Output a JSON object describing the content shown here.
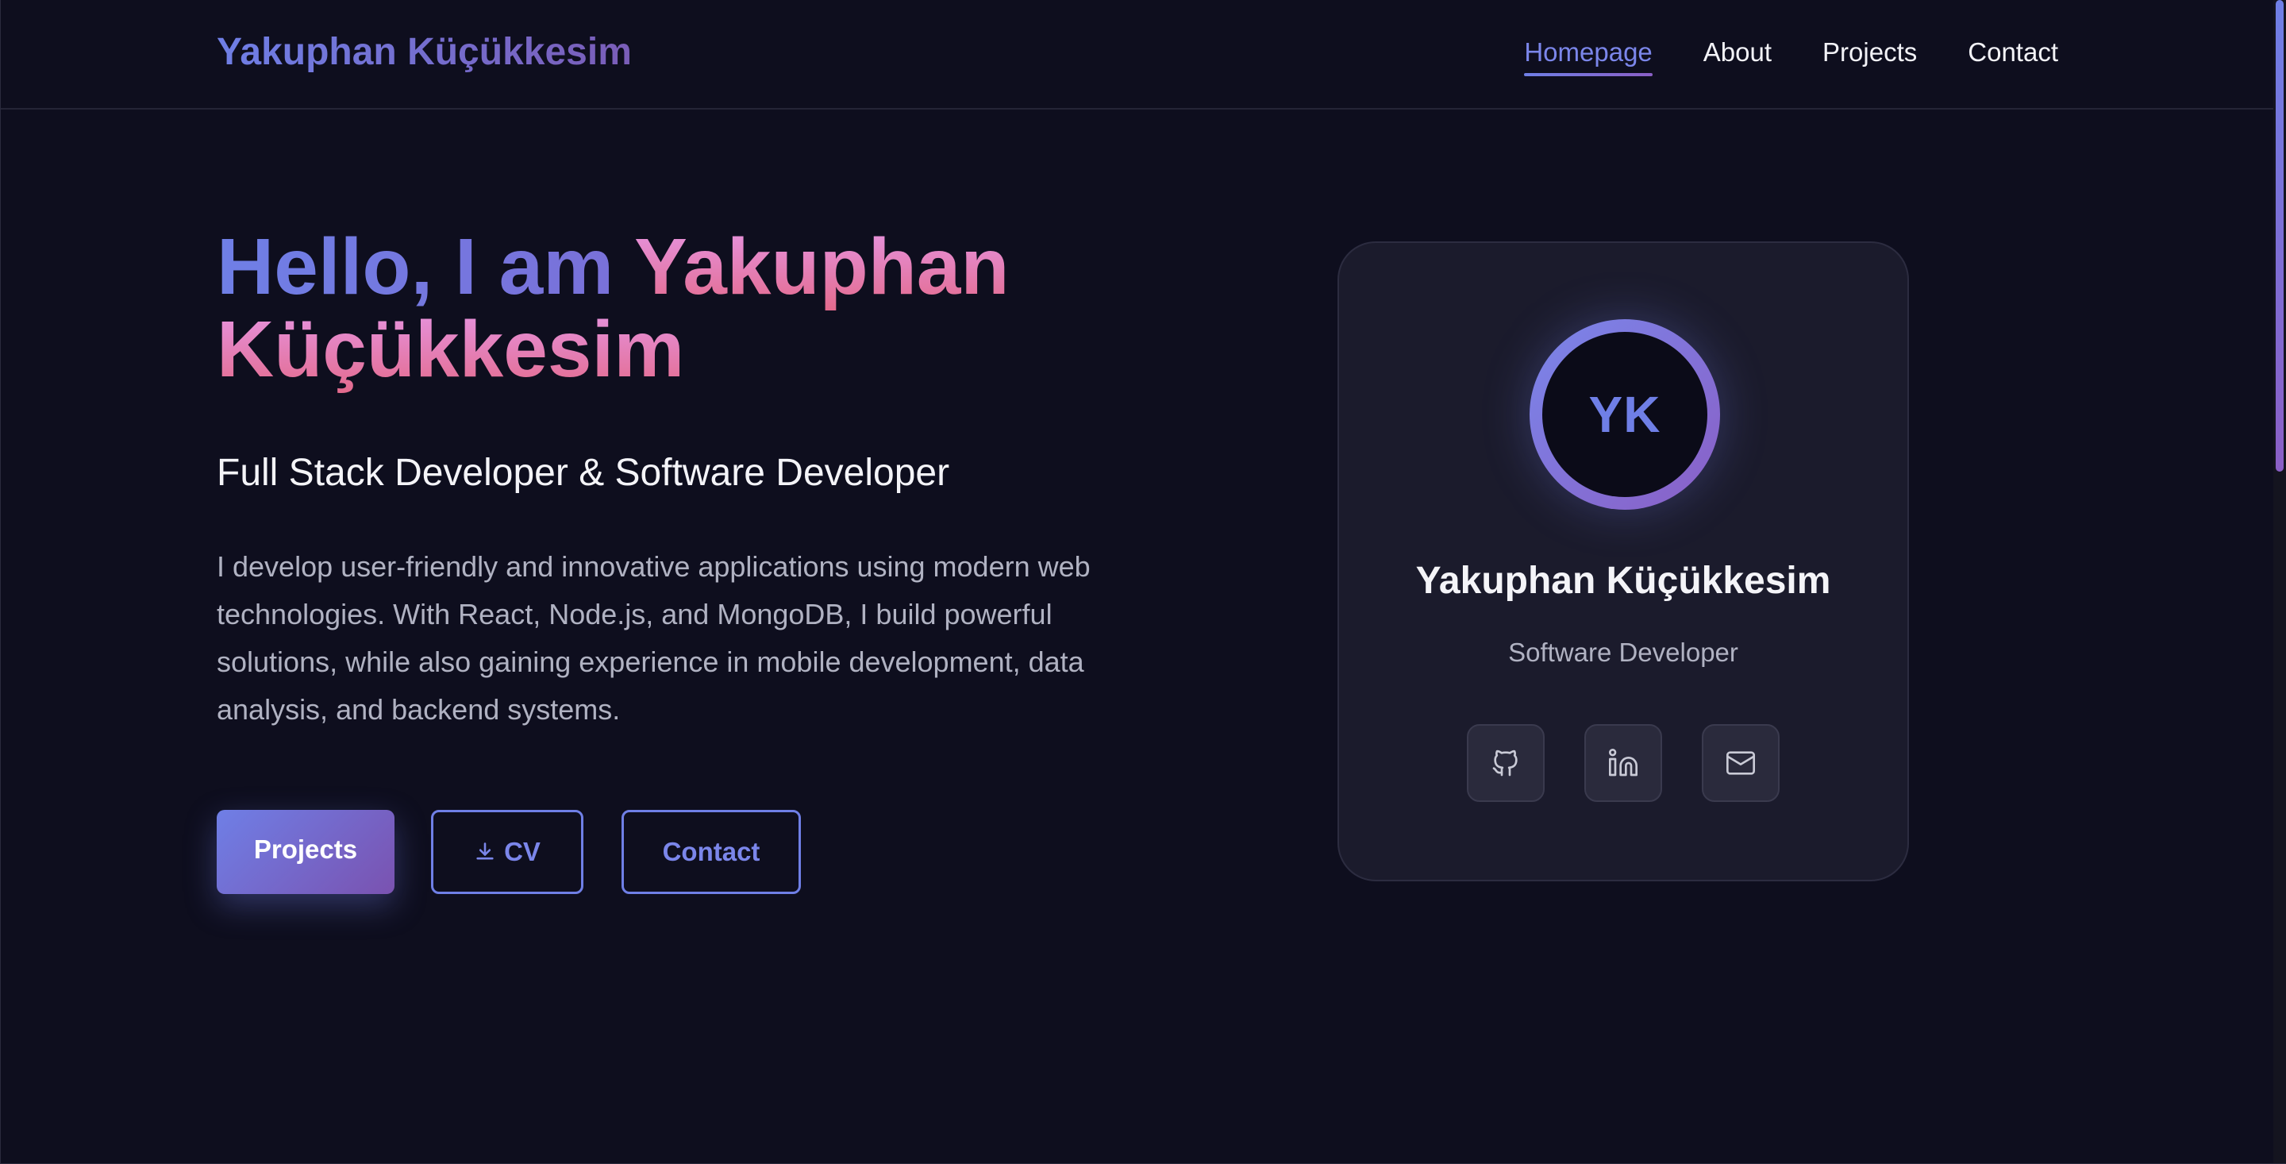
{
  "header": {
    "brand": "Yakuphan Küçükkesim",
    "nav": [
      {
        "label": "Homepage",
        "active": true
      },
      {
        "label": "About",
        "active": false
      },
      {
        "label": "Projects",
        "active": false
      },
      {
        "label": "Contact",
        "active": false
      }
    ]
  },
  "hero": {
    "title_part1": "Hello, I am ",
    "title_part2": "Yakuphan Küçükkesim",
    "subtitle": "Full Stack Developer & Software Developer",
    "description": "I develop user-friendly and innovative applications using modern web technologies. With React, Node.js, and MongoDB, I build powerful solutions, while also gaining experience in mobile development, data analysis, and backend systems.",
    "buttons": {
      "projects": "Projects",
      "cv": "CV",
      "contact": "Contact"
    }
  },
  "card": {
    "initials": "YK",
    "name": "Yakuphan Küçükkesim",
    "role": "Software Developer",
    "socials": [
      {
        "icon": "github-icon"
      },
      {
        "icon": "linkedin-icon"
      },
      {
        "icon": "mail-icon"
      }
    ]
  },
  "colors": {
    "background": "#0e0e1e",
    "accent": "#6f7fe6",
    "accent_purple": "#7a52b0",
    "pink": "#e36a8c",
    "card": "#1b1b2c"
  }
}
